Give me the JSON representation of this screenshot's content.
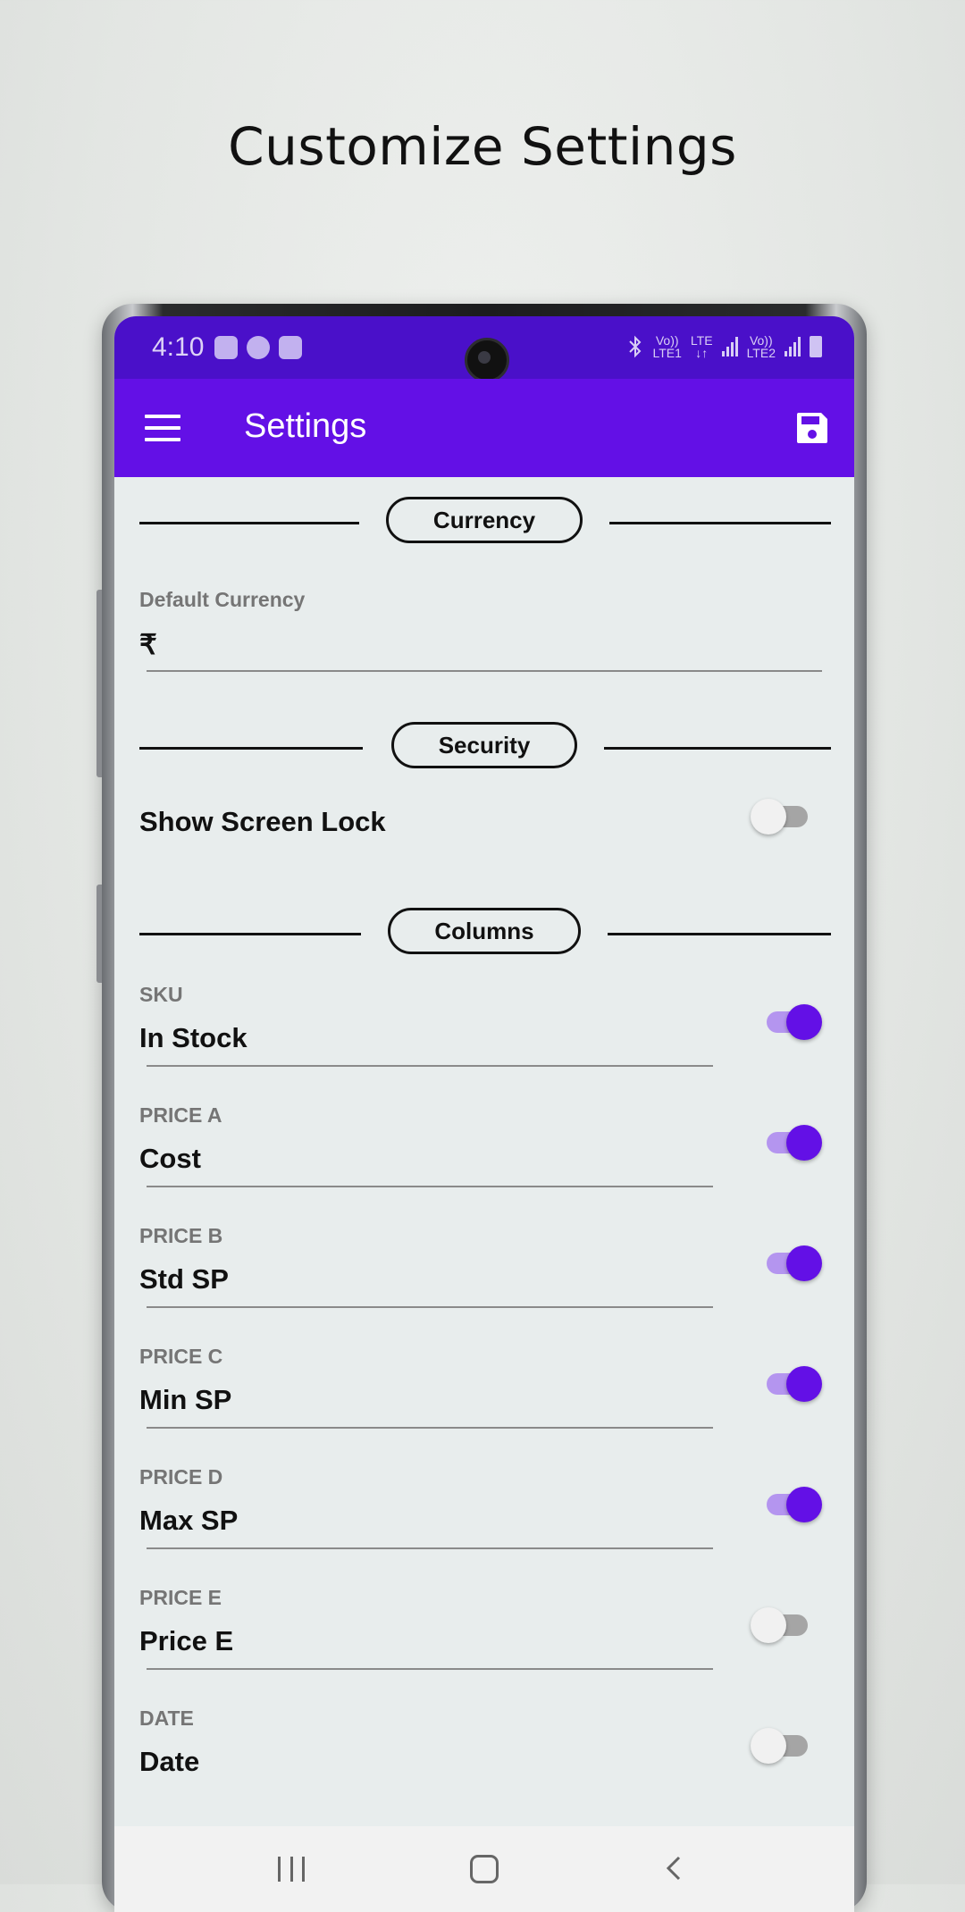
{
  "promo": {
    "title": "Customize Settings"
  },
  "status_bar": {
    "time": "4:10",
    "sim1_top": "Vo))",
    "sim1_bottom": "LTE1",
    "lte_top": "LTE",
    "sim2_top": "Vo))",
    "sim2_bottom": "LTE2"
  },
  "app_bar": {
    "title": "Settings"
  },
  "sections": {
    "currency": "Currency",
    "security": "Security",
    "columns": "Columns"
  },
  "currency": {
    "label": "Default Currency",
    "value": "₹"
  },
  "security": {
    "show_screen_lock_label": "Show Screen Lock",
    "show_screen_lock_enabled": false
  },
  "columns": [
    {
      "label": "SKU",
      "value": "In Stock",
      "enabled": true
    },
    {
      "label": "PRICE A",
      "value": "Cost",
      "enabled": true
    },
    {
      "label": "PRICE B",
      "value": "Std SP",
      "enabled": true
    },
    {
      "label": "PRICE C",
      "value": "Min SP",
      "enabled": true
    },
    {
      "label": "PRICE D",
      "value": "Max SP",
      "enabled": true
    },
    {
      "label": "PRICE E",
      "value": "Price E",
      "enabled": false
    },
    {
      "label": "DATE",
      "value": "Date",
      "enabled": false
    }
  ],
  "colors": {
    "primary": "#6310e6",
    "status_bar": "#4a10c9",
    "toggle_track_on": "#b495ef"
  },
  "icons": {
    "menu": "menu-icon",
    "save": "save-icon",
    "recent": "recent-apps-icon",
    "home": "home-icon",
    "back": "back-icon"
  }
}
